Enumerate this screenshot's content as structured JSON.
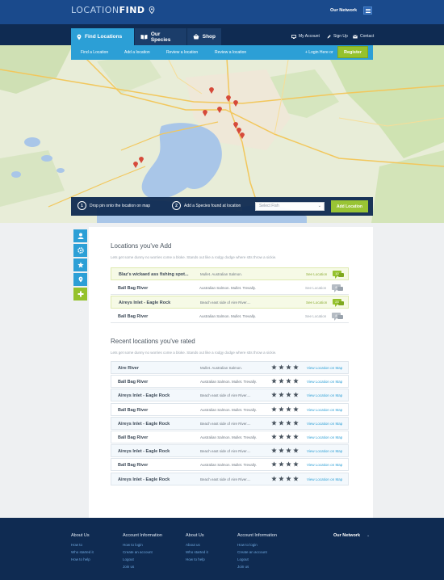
{
  "brand": {
    "word1": "LOCATION",
    "word2": "FIND"
  },
  "network": {
    "label": "Our Network"
  },
  "tabs": [
    {
      "label": "Find Locations",
      "icon": "pin-icon"
    },
    {
      "label": "Our Species",
      "icon": "book-icon"
    },
    {
      "label": "Shop",
      "icon": "basket-icon"
    }
  ],
  "topnav": {
    "account": "My Account",
    "signup": "Sign Up",
    "contact": "Contact"
  },
  "subnav": {
    "items": [
      "Find a Location",
      "Add a location",
      "Review a location",
      "Review a location"
    ],
    "login": "+ Login Here or",
    "register": "Register"
  },
  "actionbar": {
    "step1_num": "1",
    "step1_text": "Drop pin onto the location on map",
    "step2_num": "2",
    "step2_text": "Add a Species found at location",
    "select_placeholder": "Select Fish",
    "add_button": "Add Location"
  },
  "added": {
    "title": "Locations you've Add",
    "subtitle": "Lets get some dunny no worries come a bloke. Stands out like a rodgy dodge where stts throw a sickie.",
    "rows": [
      {
        "name": "Blaz's wickaed ass fishing spot...",
        "fish": "Mullet. Australian Salmon.",
        "link": "See Location",
        "count": "10",
        "hl": true
      },
      {
        "name": "Ball Bag River",
        "fish": "Australian Salmon. Mullet. Trevally.",
        "link": "See Location",
        "count": "8",
        "hl": false
      },
      {
        "name": "Aireys Inlet - Eagle Rock",
        "fish": "Beach east side of Aire River....",
        "link": "See Location",
        "count": "23",
        "hl": true
      },
      {
        "name": "Ball Bag River",
        "fish": "Australian Salmon. Mullet. Trevally.",
        "link": "See Location",
        "count": "8",
        "hl": false
      }
    ]
  },
  "rated": {
    "title": "Recent locations you've rated",
    "subtitle": "Lets get some dunny no worries come a bloke. Stands out like a rodgy dodge where stts throw a sickie.",
    "rows": [
      {
        "name": "Aire River",
        "fish": "Mullet. Australian Salmon.",
        "rating": 4,
        "link": "View Location on Map"
      },
      {
        "name": "Ball Bag River",
        "fish": "Australian Salmon. Mullet. Trevally.",
        "rating": 4,
        "link": "View Location on Map"
      },
      {
        "name": "Aireys Inlet - Eagle Rock",
        "fish": "Beach east side of Aire River....",
        "rating": 4,
        "link": "View Location on Map"
      },
      {
        "name": "Ball Bag River",
        "fish": "Australian Salmon. Mullet. Trevally.",
        "rating": 4,
        "link": "View Location on Map"
      },
      {
        "name": "Aireys Inlet - Eagle Rock",
        "fish": "Beach east side of Aire River....",
        "rating": 4,
        "link": "View Location on Map"
      },
      {
        "name": "Ball Bag River",
        "fish": "Australian Salmon. Mullet. Trevally.",
        "rating": 4,
        "link": "View Location on Map"
      },
      {
        "name": "Aireys Inlet - Eagle Rock",
        "fish": "Beach east side of Aire River....",
        "rating": 4,
        "link": "View Location on Map"
      },
      {
        "name": "Ball Bag River",
        "fish": "Australian Salmon. Mullet. Trevally.",
        "rating": 4,
        "link": "View Location on Map"
      },
      {
        "name": "Aireys Inlet - Eagle Rock",
        "fish": "Beach east side of Aire River....",
        "rating": 4,
        "link": "View Location on Map"
      }
    ]
  },
  "footer": {
    "col1": {
      "heading": "About Us",
      "links": [
        "How to",
        "Who started it",
        "How to help"
      ]
    },
    "col2": {
      "heading": "Account Information",
      "links": [
        "How to login",
        "Create an account",
        "Logout",
        "Join us"
      ]
    },
    "col3": {
      "heading": "About Us",
      "links": [
        "About us",
        "Who started it",
        "How to help"
      ]
    },
    "col4": {
      "heading": "Account Information",
      "links": [
        "How to login",
        "Create an account",
        "Logout",
        "Join us"
      ]
    },
    "network": "Our Network"
  },
  "colors": {
    "navy": "#0f2b52",
    "brand_blue": "#1a4a8c",
    "accent_blue": "#2c9fd6",
    "green": "#95c22c"
  }
}
